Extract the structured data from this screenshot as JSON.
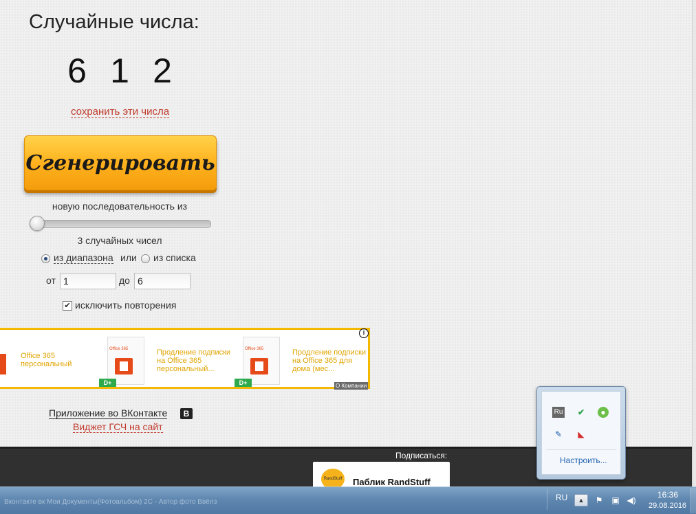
{
  "page": {
    "title": "Случайные числа:",
    "numbers": [
      "6",
      "1",
      "2"
    ],
    "save_link": "сохранить эти числа",
    "generate_button": "Сгенерировать",
    "sequence_label": "новую последовательность из",
    "slider_value": 3,
    "count_label": "3 случайных чисел",
    "mode": {
      "range_label": "из диапазона",
      "or_label": "или",
      "list_label": "из списка",
      "selected": "range"
    },
    "from_label": "от",
    "from_value": "1",
    "to_label": "до",
    "to_value": "6",
    "exclude_repeats_label": "исключить повторения",
    "exclude_repeats_checked": true
  },
  "ad": {
    "items": [
      {
        "text": "Office 365 персональный",
        "thumb_label": "Office 365",
        "badge": "D+"
      },
      {
        "text": "Продление подписки на Office 365 персональный...",
        "thumb_label": "Office 365",
        "badge": "D+"
      },
      {
        "text": "Продление подписки на Office 365 для дома (мес...",
        "thumb_label": "Office 365",
        "badge": "D+"
      }
    ],
    "info_icon": "i",
    "company_label": "О Компании",
    "accent_color": "#f5b800"
  },
  "links": {
    "vk_app": "Приложение во ВКонтакте",
    "vk_icon": "B",
    "widget": "Виджет ГСЧ на сайт"
  },
  "footer": {
    "subscribe_label": "Подписаться:",
    "public_logo": "RandStuff",
    "public_name": "Паблик RandStuff"
  },
  "taskbar": {
    "faded_text": "Вконтакте вк Мои Документы(Фотоальбом) 2С - Автор фото Ввёлз",
    "language": "RU",
    "time": "16:36",
    "date": "29.08.2016"
  },
  "tray_popup": {
    "lang_icon": "Ru",
    "configure_label": "Настроить..."
  }
}
